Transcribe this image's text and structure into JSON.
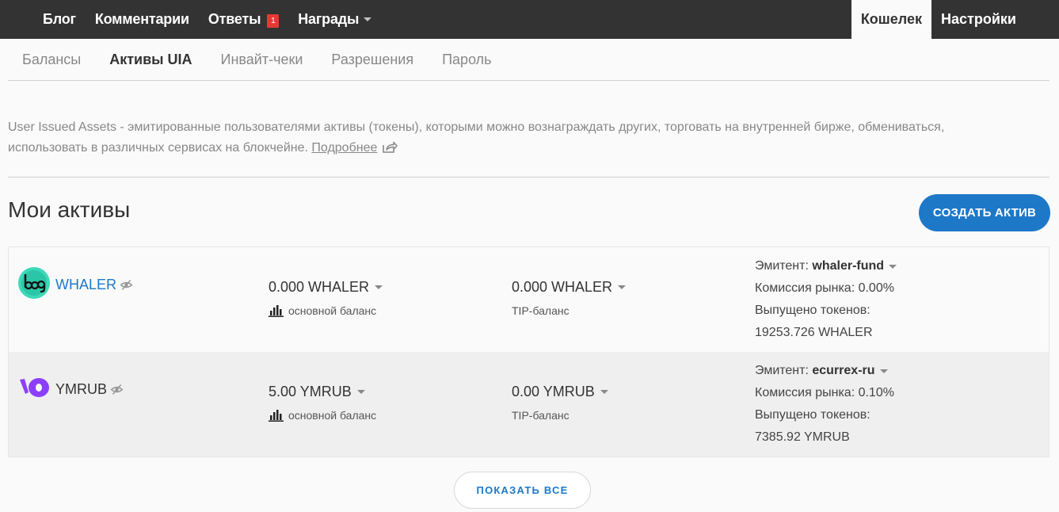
{
  "topnav": {
    "items": [
      {
        "label": "Блог"
      },
      {
        "label": "Комментарии"
      },
      {
        "label": "Ответы",
        "badge": "1"
      },
      {
        "label": "Награды"
      }
    ],
    "right": [
      {
        "label": "Кошелек",
        "active": true
      },
      {
        "label": "Настройки"
      }
    ]
  },
  "subnav": {
    "items": [
      {
        "label": "Балансы"
      },
      {
        "label": "Активы UIA",
        "active": true
      },
      {
        "label": "Инвайт-чеки"
      },
      {
        "label": "Разрешения"
      },
      {
        "label": "Пароль"
      }
    ]
  },
  "description": {
    "text": "User Issued Assets - эмитированные пользователями активы (токены), которыми можно вознаграждать других, торговать на внутренней бирже, обмениваться, использовать в различных сервисах на блокчейне.",
    "more_link": "Подробнее"
  },
  "section": {
    "title": "Мои активы",
    "create_button": "СОЗДАТЬ АКТИВ"
  },
  "assets": [
    {
      "name": "WHALER",
      "icon": "whaler-logo-icon",
      "main_balance": "0.000 WHALER",
      "main_label": "основной баланс",
      "tip_balance": "0.000 WHALER",
      "tip_label": "TIP-баланс",
      "issuer_label": "Эмитент:",
      "issuer": "whaler-fund",
      "fee": "Комиссия рынка: 0.00%",
      "supply_label": "Выпущено токенов:",
      "supply": "19253.726 WHALER"
    },
    {
      "name": "YMRUB",
      "icon": "ymrub-logo-icon",
      "main_balance": "5.00 YMRUB",
      "main_label": "основной баланс",
      "tip_balance": "0.00 YMRUB",
      "tip_label": "TIP-баланс",
      "issuer_label": "Эмитент:",
      "issuer": "ecurrex-ru",
      "fee": "Комиссия рынка: 0.10%",
      "supply_label": "Выпущено токенов:",
      "supply": "7385.92 YMRUB"
    }
  ],
  "show_all": "ПОКАЗАТЬ ВСЕ",
  "colors": {
    "topbar": "#333333",
    "accent": "#1e78c8",
    "badge": "#e53935"
  }
}
